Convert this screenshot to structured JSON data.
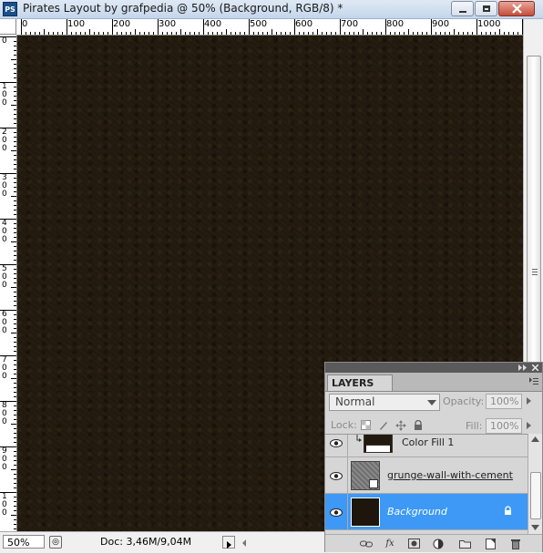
{
  "window": {
    "app_icon": "PS",
    "title": "Pirates Layout by grafpedia @ 50% (Background, RGB/8) *",
    "buttons": [
      "minimize-icon",
      "restore-icon",
      "close-icon"
    ]
  },
  "rulers": {
    "top_labels": [
      "0",
      "100",
      "200",
      "300",
      "400",
      "500",
      "600",
      "700",
      "800",
      "900",
      "1000"
    ],
    "left_labels": [
      "0",
      "100",
      "200",
      "300",
      "400",
      "500",
      "600",
      "700",
      "800",
      "900",
      "100"
    ]
  },
  "canvas": {
    "color": "#231a0f"
  },
  "status": {
    "zoom": "50%",
    "doc": "Doc: 3,46M/9,04M"
  },
  "layers_panel": {
    "tab": "LAYERS",
    "blend_mode": "Normal",
    "opacity_label": "Opacity:",
    "opacity_value": "100%",
    "lock_label": "Lock:",
    "fill_label": "Fill:",
    "fill_value": "100%",
    "layers": [
      {
        "name": "Color Fill 1",
        "selected": false
      },
      {
        "name": "grunge-wall-with-cement",
        "selected": false
      },
      {
        "name": "Background",
        "selected": true
      }
    ],
    "selected_color": "#3d99f5",
    "footer_icons": [
      "link-icon",
      "fx-icon",
      "mask-icon",
      "adjustment-icon",
      "group-icon",
      "new-layer-icon",
      "trash-icon"
    ]
  }
}
